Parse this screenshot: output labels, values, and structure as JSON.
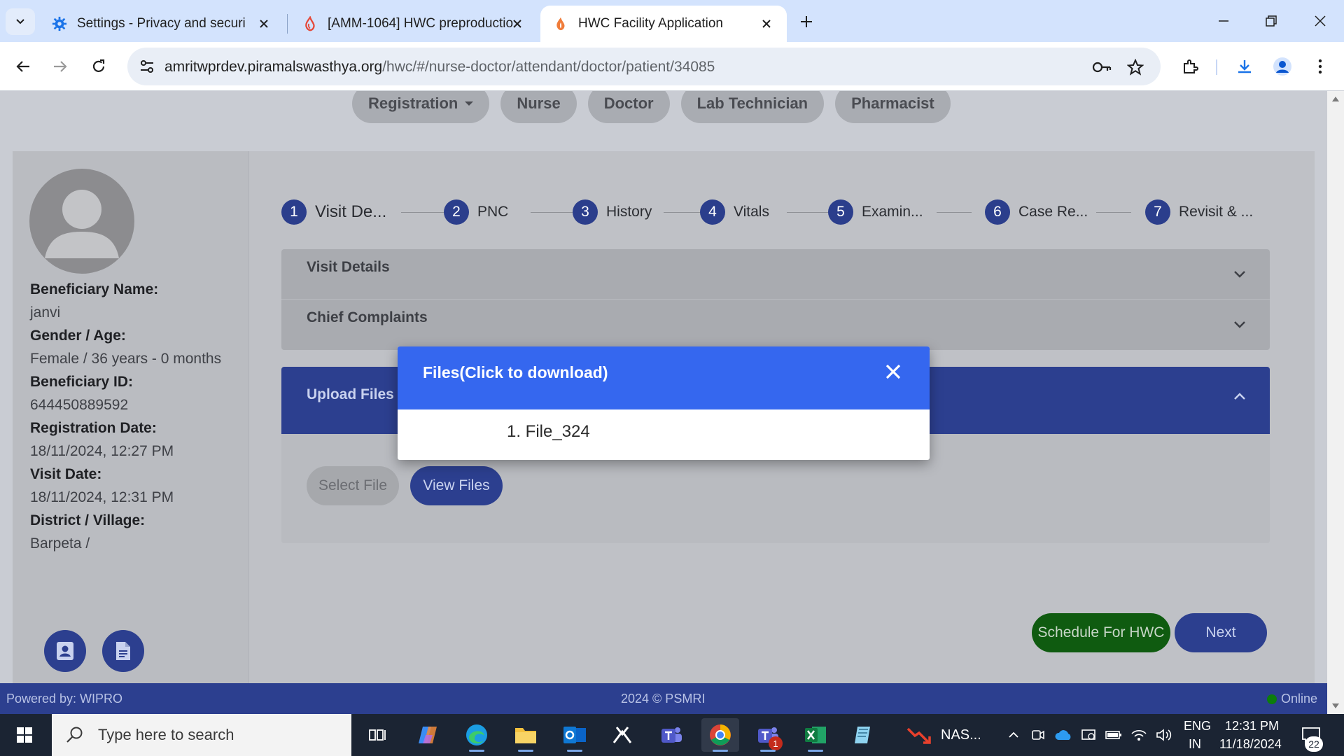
{
  "browser": {
    "tabs": [
      {
        "title": "Settings - Privacy and security",
        "icon": "gear-icon"
      },
      {
        "title": "[AMM-1064] HWC preproductio",
        "icon": "jira-flame-icon"
      },
      {
        "title": "HWC Facility Application",
        "icon": "app-flame-icon",
        "active": true
      }
    ],
    "url_host": "amritwprdev.piramalswasthya.org",
    "url_path": "/hwc/#/nurse-doctor/attendant/doctor/patient/34085"
  },
  "nav": {
    "roles": [
      "Registration",
      "Nurse",
      "Doctor",
      "Lab Technician",
      "Pharmacist"
    ]
  },
  "beneficiary": {
    "name_label": "Beneficiary Name:",
    "name": "janvi",
    "gender_age_label": "Gender / Age:",
    "gender_age": "Female / 36 years - 0 months",
    "id_label": "Beneficiary ID:",
    "id": "644450889592",
    "reg_date_label": "Registration Date:",
    "reg_date": "18/11/2024, 12:27 PM",
    "visit_date_label": "Visit Date:",
    "visit_date": "18/11/2024, 12:31 PM",
    "district_label": "District / Village:",
    "district": "Barpeta /"
  },
  "stepper": [
    {
      "num": "1",
      "label": "Visit De..."
    },
    {
      "num": "2",
      "label": "PNC"
    },
    {
      "num": "3",
      "label": "History"
    },
    {
      "num": "4",
      "label": "Vitals"
    },
    {
      "num": "5",
      "label": "Examin..."
    },
    {
      "num": "6",
      "label": "Case Re..."
    },
    {
      "num": "7",
      "label": "Revisit & ..."
    }
  ],
  "sections": {
    "visit_details": "Visit Details",
    "chief_complaints": "Chief Complaints",
    "upload_files": "Upload Files"
  },
  "upload": {
    "select_file": "Select File",
    "view_files": "View Files"
  },
  "actions": {
    "schedule": "Schedule For HWC",
    "next": "Next"
  },
  "modal": {
    "title": "Files(Click to download)",
    "files": [
      "1. File_324"
    ]
  },
  "footer": {
    "powered_by": "Powered by: WIPRO",
    "copyright": "2024 © PSMRI",
    "status": "Online"
  },
  "taskbar": {
    "search_placeholder": "Type here to search",
    "nas_label": "NAS...",
    "lang": "ENG",
    "region": "IN",
    "time": "12:31 PM",
    "date": "11/18/2024",
    "notifications": "22",
    "teams_badge": "1"
  },
  "colors": {
    "primary": "#3567ef",
    "primary_dim": "#2c3f8f",
    "success": "#0f5b10",
    "tabbar": "#d3e3fd"
  }
}
